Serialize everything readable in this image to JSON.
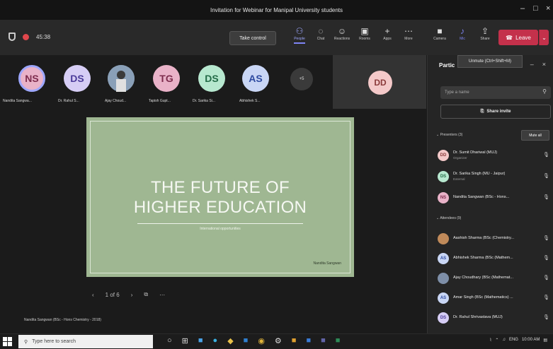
{
  "window": {
    "title": "Invitation for Webinar for Manipal University students"
  },
  "toolbar": {
    "timer": "45:38",
    "take_control": "Take control",
    "buttons": [
      {
        "label": "People",
        "icon": "people-icon"
      },
      {
        "label": "Chat",
        "icon": "chat-icon"
      },
      {
        "label": "Reactions",
        "icon": "reactions-icon"
      },
      {
        "label": "Rooms",
        "icon": "rooms-icon"
      },
      {
        "label": "Apps",
        "icon": "apps-icon"
      },
      {
        "label": "More",
        "icon": "more-icon"
      },
      {
        "label": "Camera",
        "icon": "camera-icon"
      },
      {
        "label": "Mic",
        "icon": "mic-icon"
      },
      {
        "label": "Share",
        "icon": "share-icon"
      }
    ],
    "leave": "Leave"
  },
  "tooltip": "Unmute (Ctrl+Shift+M)",
  "gallery": {
    "participants": [
      {
        "initials": "NS",
        "name": "Nandita Sangwa..."
      },
      {
        "initials": "DS",
        "name": "Dr. Rahul S..."
      },
      {
        "initials": "",
        "name": "Ajay Choud..."
      },
      {
        "initials": "TG",
        "name": "Tapish Gupt..."
      },
      {
        "initials": "DS",
        "name": "Dr. Sarika Si..."
      },
      {
        "initials": "AS",
        "name": "Abhishek S..."
      }
    ],
    "more_count": "+5",
    "self_initials": "DD"
  },
  "slide": {
    "title_line1": "THE FUTURE OF",
    "title_line2": "HIGHER EDUCATION",
    "subtitle": "International opportunities",
    "author": "Nandita Sangwan",
    "page": "1 of 6"
  },
  "presenter_label": "Nandita Sangwan (BSc - Hons Chemistry - 2018)",
  "panel": {
    "title": "Partic",
    "search_placeholder": "Type a name",
    "share_invite": "Share invite",
    "presenters_header": "Presenters (3)",
    "mute_all": "Mute all",
    "presenters": [
      {
        "initials": "DD",
        "name": "Dr. Sumit Dhariwal (MUJ)",
        "role": "Organizer",
        "bg": "#f4c9c9",
        "fg": "#8b3b3b"
      },
      {
        "initials": "DS",
        "name": "Dr. Sarika Singh (MU - Jaipur)",
        "role": "External",
        "bg": "#b7e8cf",
        "fg": "#236b47"
      },
      {
        "initials": "NS",
        "name": "Nandita Sangwan (BSc - Hons...",
        "role": "",
        "bg": "#e9b2c8",
        "fg": "#7d2c4d"
      }
    ],
    "attendees_header": "Attendees (9)",
    "attendees": [
      {
        "initials": "",
        "name": "Aashish Sharma (BSc (Chemistry...",
        "bg": "#c08a5a",
        "fg": "#fff"
      },
      {
        "initials": "AS",
        "name": "Abhishek Sharma (BSc (Mathem...",
        "bg": "#c9d6f5",
        "fg": "#2d4aa0"
      },
      {
        "initials": "",
        "name": "Ajay Choudhary (BSc (Mathemat...",
        "bg": "#7e8fa8",
        "fg": "#fff"
      },
      {
        "initials": "AS",
        "name": "Amar Singh (BSc (Mathematics) ...",
        "bg": "#c9d6f5",
        "fg": "#2d4aa0"
      },
      {
        "initials": "DS",
        "name": "Dr. Rahul Shrivastava (MUJ)",
        "bg": "#d6cdf5",
        "fg": "#4b3b9a"
      }
    ]
  },
  "taskbar": {
    "search_placeholder": "Type here to search",
    "tray_lang": "ENG",
    "tray_time": "10:00 AM"
  }
}
